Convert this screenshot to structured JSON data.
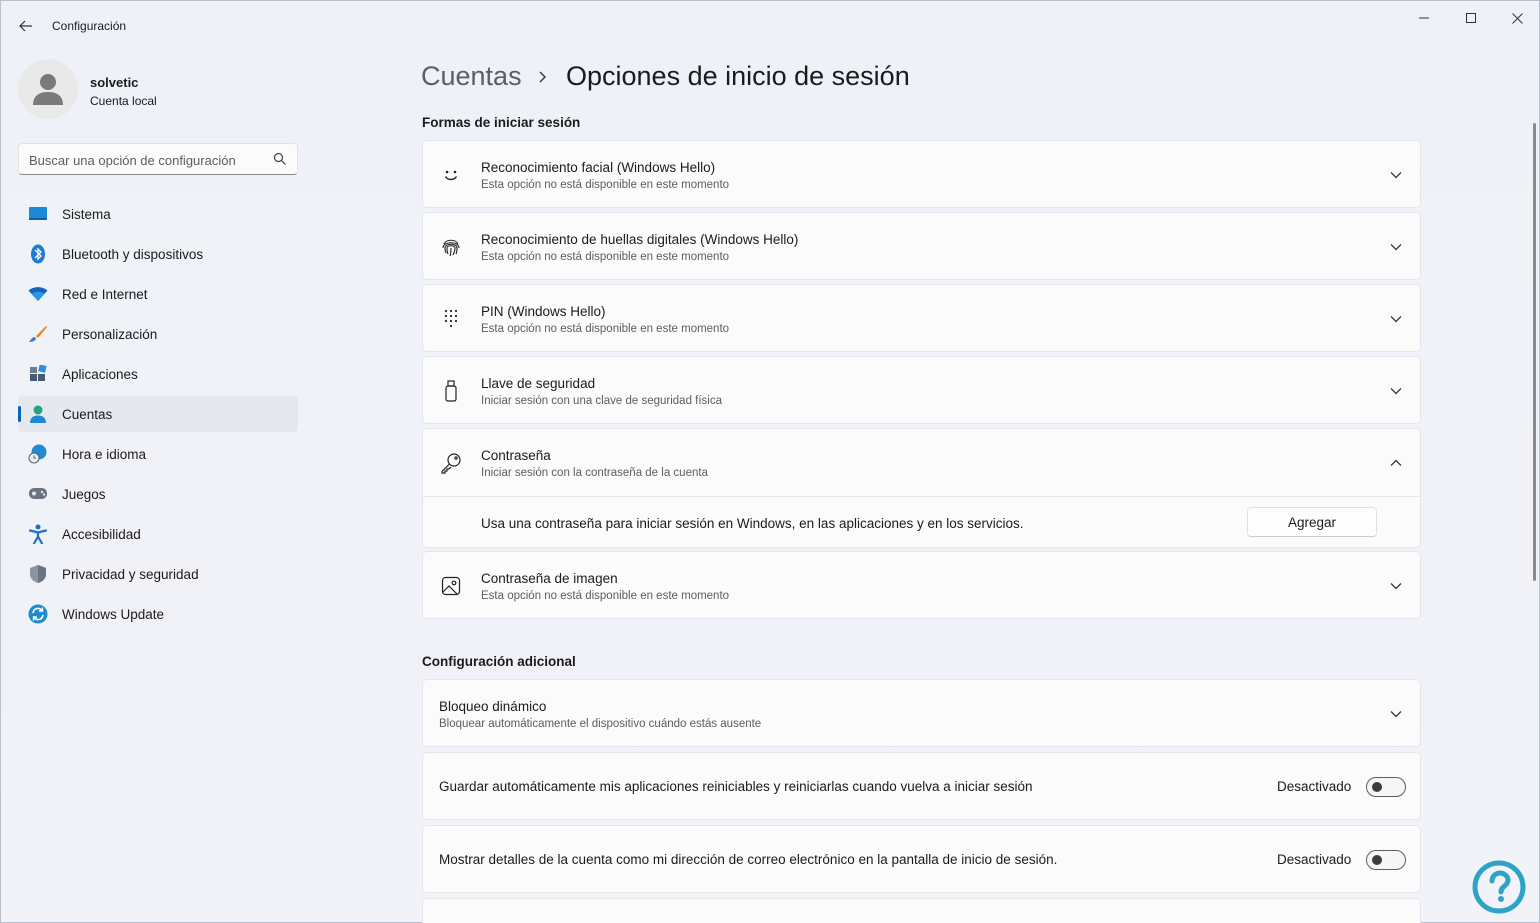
{
  "window": {
    "app_title": "Configuración",
    "controls": {
      "minimize": "minimize-icon",
      "maximize": "maximize-icon",
      "close": "close-icon"
    }
  },
  "profile": {
    "name": "solvetic",
    "account_type": "Cuenta local"
  },
  "search": {
    "placeholder": "Buscar una opción de configuración"
  },
  "sidebar": {
    "items": [
      {
        "label": "Sistema",
        "icon": "monitor-icon",
        "active": false
      },
      {
        "label": "Bluetooth y dispositivos",
        "icon": "bluetooth-icon",
        "active": false
      },
      {
        "label": "Red e Internet",
        "icon": "wifi-icon",
        "active": false
      },
      {
        "label": "Personalización",
        "icon": "brush-icon",
        "active": false
      },
      {
        "label": "Aplicaciones",
        "icon": "apps-icon",
        "active": false
      },
      {
        "label": "Cuentas",
        "icon": "person-icon",
        "active": true
      },
      {
        "label": "Hora e idioma",
        "icon": "globe-clock-icon",
        "active": false
      },
      {
        "label": "Juegos",
        "icon": "gamepad-icon",
        "active": false
      },
      {
        "label": "Accesibilidad",
        "icon": "accessibility-icon",
        "active": false
      },
      {
        "label": "Privacidad y seguridad",
        "icon": "shield-icon",
        "active": false
      },
      {
        "label": "Windows Update",
        "icon": "update-icon",
        "active": false
      }
    ]
  },
  "breadcrumb": {
    "parent": "Cuentas",
    "current": "Opciones de inicio de sesión"
  },
  "sign_in": {
    "title": "Formas de iniciar sesión",
    "options": [
      {
        "title": "Reconocimiento facial (Windows Hello)",
        "subtitle": "Esta opción no está disponible en este momento",
        "icon": "face-icon"
      },
      {
        "title": "Reconocimiento de huellas digitales (Windows Hello)",
        "subtitle": "Esta opción no está disponible en este momento",
        "icon": "fingerprint-icon"
      },
      {
        "title": "PIN (Windows Hello)",
        "subtitle": "Esta opción no está disponible en este momento",
        "icon": "pin-keypad-icon"
      },
      {
        "title": "Llave de seguridad",
        "subtitle": "Iniciar sesión con una clave de seguridad física",
        "icon": "usb-key-icon"
      },
      {
        "title": "Contraseña",
        "subtitle": "Iniciar sesión con la contraseña de la cuenta",
        "icon": "key-icon",
        "expanded": true,
        "expanded_text": "Usa una contraseña para iniciar sesión en Windows, en las aplicaciones y en los servicios.",
        "button_label": "Agregar"
      },
      {
        "title": "Contraseña de imagen",
        "subtitle": "Esta opción no está disponible en este momento",
        "icon": "picture-icon"
      }
    ]
  },
  "additional": {
    "title": "Configuración adicional",
    "dynamic_lock": {
      "title": "Bloqueo dinámico",
      "subtitle": "Bloquear automáticamente el dispositivo cuándo estás ausente"
    },
    "toggles": [
      {
        "text": "Guardar automáticamente mis aplicaciones reiniciables y reiniciarlas cuando vuelva a iniciar sesión",
        "state_label": "Desactivado",
        "on": false
      },
      {
        "text": "Mostrar detalles de la cuenta como mi dirección de correo electrónico en la pantalla de inicio de sesión.",
        "state_label": "Desactivado",
        "on": false
      }
    ]
  },
  "colors": {
    "accent": "#0067c0",
    "background": "#eef1f7",
    "card": "#fbfbfc"
  }
}
